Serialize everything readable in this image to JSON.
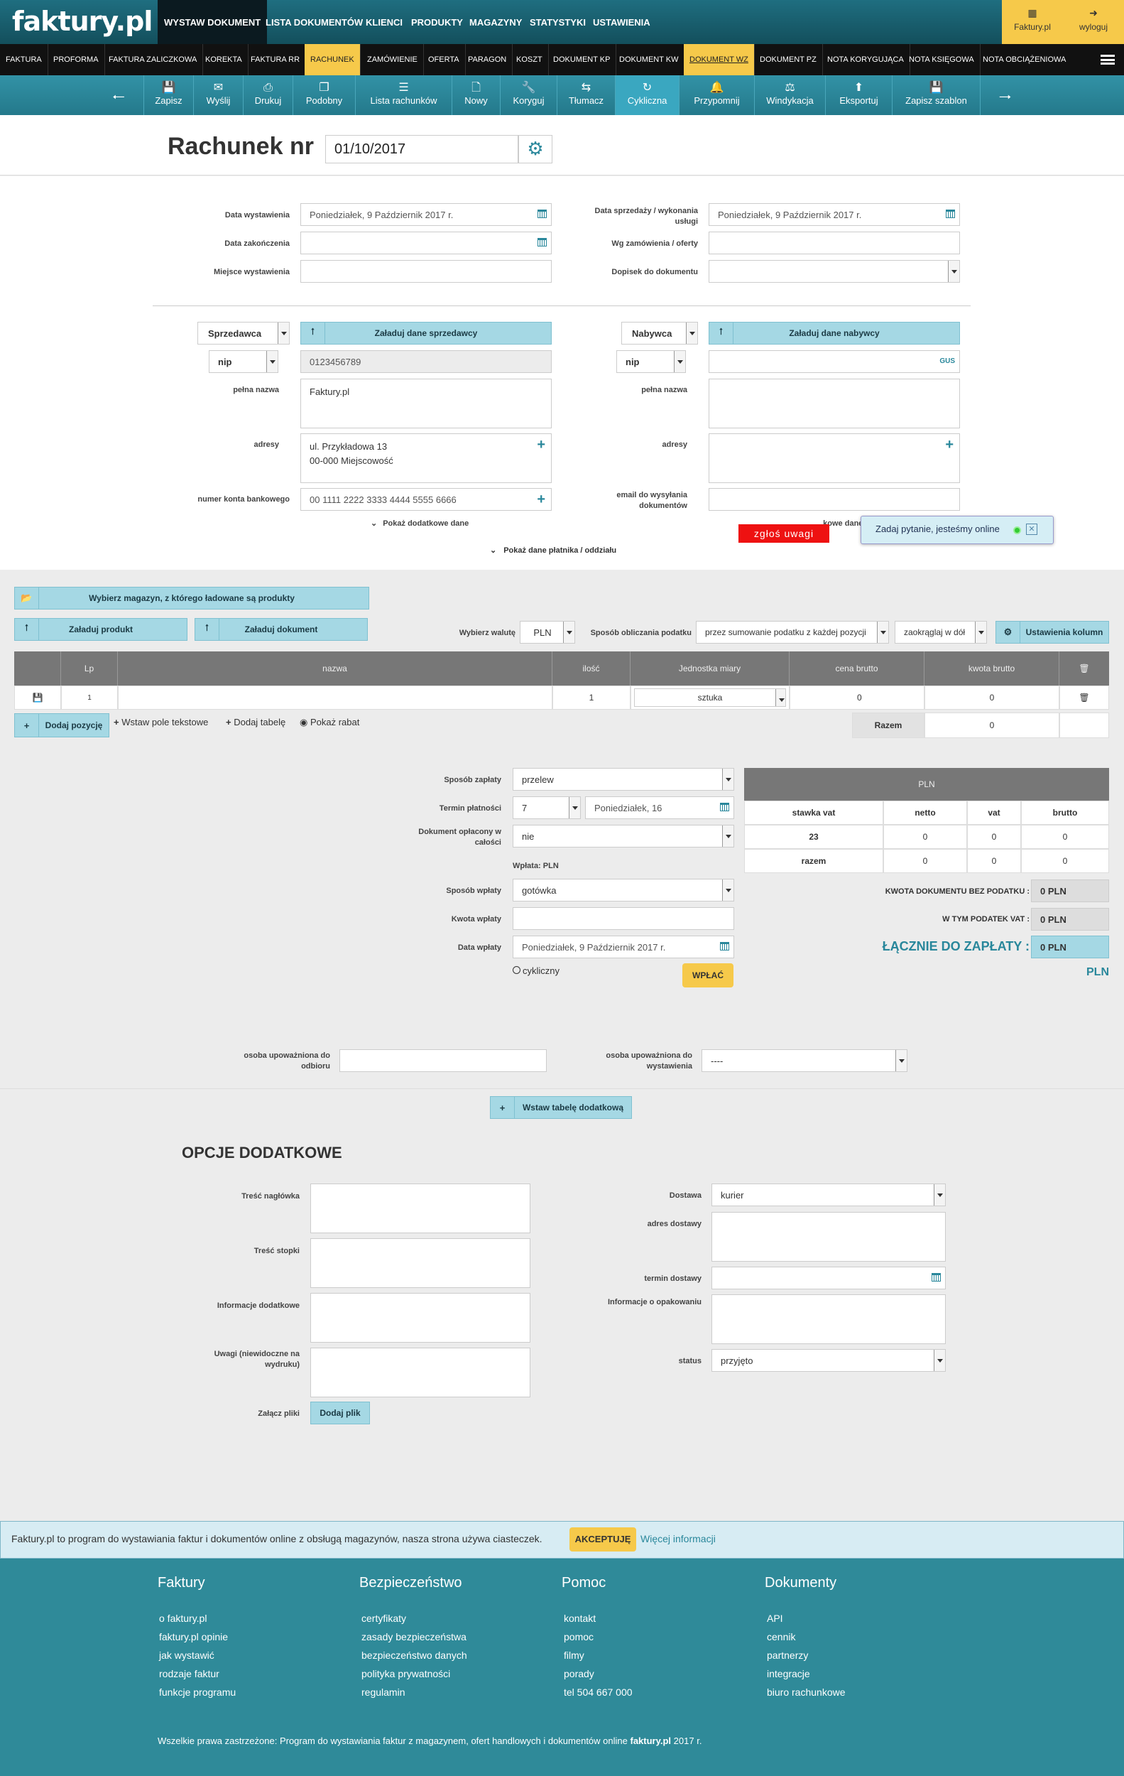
{
  "header": {
    "logo": "faktury.pl",
    "nav": [
      "WYSTAW DOKUMENT",
      "LISTA DOKUMENTÓW",
      "KLIENCI",
      "PRODUKTY",
      "MAGAZYNY",
      "STATYSTYKI",
      "USTAWIENIA"
    ],
    "account_label": "Faktury.pl",
    "logout_label": "wyloguj"
  },
  "doc_types": [
    "FAKTURA",
    "PROFORMA",
    "FAKTURA ZALICZKOWA",
    "KOREKTA",
    "FAKTURA RR",
    "RACHUNEK",
    "ZAMÓWIENIE",
    "OFERTA",
    "PARAGON",
    "KOSZT",
    "DOKUMENT KP",
    "DOKUMENT KW",
    "DOKUMENT WZ",
    "DOKUMENT PZ",
    "NOTA KORYGUJĄCA",
    "NOTA KSIĘGOWA",
    "NOTA OBCIĄŻENIOWA"
  ],
  "toolbar": [
    "Zapisz",
    "Wyślij",
    "Drukuj",
    "Podobny",
    "Lista rachunków",
    "Nowy",
    "Koryguj",
    "Tłumacz",
    "Cykliczna",
    "Przypomnij",
    "Windykacja",
    "Eksportuj",
    "Zapisz szablon"
  ],
  "doc": {
    "title": "Rachunek nr",
    "number": "01/10/2017"
  },
  "dates": {
    "issue_label": "Data wystawienia",
    "issue_value": "Poniedziałek, 9 Październik 2017 r.",
    "end_label": "Data zakończenia",
    "place_label": "Miejsce wystawienia",
    "sale_label": "Data sprzedaży / wykonania usługi",
    "sale_value": "Poniedziałek, 9 Październik 2017 r.",
    "order_label": "Wg zamówienia / oferty",
    "addon_label": "Dopisek do dokumentu"
  },
  "seller": {
    "role": "Sprzedawca",
    "load_btn": "Załaduj dane sprzedawcy",
    "id_type": "nip",
    "nip": "0123456789",
    "name_label": "pełna nazwa",
    "name": "Faktury.pl",
    "addr_label": "adresy",
    "addr1": "ul. Przykładowa 13",
    "addr2": "00-000 Miejscowość",
    "bank_label": "numer konta bankowego",
    "bank": "00 1111 2222 3333 4444 5555 6666",
    "more": "Pokaż dodatkowe dane"
  },
  "buyer": {
    "role": "Nabywca",
    "load_btn": "Załaduj dane nabywcy",
    "id_type": "nip",
    "gus": "GUS",
    "name_label": "pełna nazwa",
    "addr_label": "adresy",
    "email_label": "email do wysyłania dokumentów",
    "more_partial": "...kowe dane"
  },
  "payer_link": "Pokaż dane płatnika / oddziału",
  "report_btn": "zgłoś uwagi",
  "chat_text": "Zadaj pytanie, jesteśmy online",
  "products": {
    "warehouse_btn": "Wybierz magazyn, z którego ładowane są produkty",
    "load_product": "Załaduj produkt",
    "load_doc": "Załaduj dokument",
    "currency_label": "Wybierz walutę",
    "currency": "PLN",
    "tax_label": "Sposób obliczania podatku",
    "tax_method": "przez sumowanie podatku z każdej pozycji",
    "rounding": "zaokrąglaj w dół",
    "columns_btn": "Ustawienia kolumn",
    "headers": [
      "Lp",
      "nazwa",
      "ilość",
      "Jednostka miary",
      "cena brutto",
      "kwota brutto"
    ],
    "row": {
      "lp": "1",
      "qty": "1",
      "unit": "sztuka",
      "price": "0",
      "amount": "0"
    },
    "add_btn": "Dodaj pozycję",
    "text_field": "Wstaw pole tekstowe",
    "add_table": "Dodaj tabelę",
    "discount": "Pokaż rabat",
    "sum_label": "Razem",
    "sum_value": "0"
  },
  "payment": {
    "method_label": "Sposób zapłaty",
    "method": "przelew",
    "term_label": "Termin płatności",
    "term_days": "7",
    "term_date": "Poniedziałek, 16",
    "paid_label": "Dokument opłacony w całości",
    "paid": "nie",
    "deposit_label": "Wpłata: PLN",
    "dep_method_label": "Sposób wpłaty",
    "dep_method": "gotówka",
    "dep_amount_label": "Kwota wpłaty",
    "dep_date_label": "Data wpłaty",
    "dep_date": "Poniedziałek, 9 Październik 2017 r.",
    "cyclic": "cykliczny",
    "pay_btn": "WPŁAĆ"
  },
  "vat": {
    "currency": "PLN",
    "headers": [
      "stawka vat",
      "netto",
      "vat",
      "brutto"
    ],
    "rows": [
      [
        "23",
        "0",
        "0",
        "0"
      ],
      [
        "razem",
        "0",
        "0",
        "0"
      ]
    ],
    "net_label": "KWOTA DOKUMENTU BEZ PODATKU :",
    "net": "0 PLN",
    "tax_label": "W TYM PODATEK VAT :",
    "tax": "0 PLN",
    "total_label": "ŁĄCZNIE DO ZAPŁATY :",
    "total": "0 PLN",
    "total_currency": "PLN"
  },
  "persons": {
    "receive_label": "osoba upoważniona do odbioru",
    "issue_label": "osoba upoważniona do wystawienia",
    "issue_value": "----"
  },
  "extra_table_btn": "Wstaw tabelę dodatkową",
  "options": {
    "title": "OPCJE DODATKOWE",
    "header_label": "Treść nagłówka",
    "footer_label": "Treść stopki",
    "info_label": "Informacje dodatkowe",
    "notes_label": "Uwagi (niewidoczne na wydruku)",
    "attach_label": "Załącz pliki",
    "attach_btn": "Dodaj plik",
    "delivery_label": "Dostawa",
    "delivery": "kurier",
    "addr_label": "adres dostawy",
    "term_label": "termin dostawy",
    "pack_label": "Informacje o opakowaniu",
    "status_label": "status",
    "status": "przyjęto"
  },
  "cookie": {
    "text": "Faktury.pl to program do wystawiania faktur i dokumentów online z obsługą magazynów, nasza strona używa ciasteczek.",
    "accept": "AKCEPTUJĘ",
    "more": "Więcej informacji"
  },
  "footer": {
    "cols": [
      {
        "title": "Faktury",
        "links": [
          "o faktury.pl",
          "faktury.pl opinie",
          "jak wystawić",
          "rodzaje faktur",
          "funkcje programu"
        ]
      },
      {
        "title": "Bezpieczeństwo",
        "links": [
          "certyfikaty",
          "zasady bezpieczeństwa",
          "bezpieczeństwo danych",
          "polityka prywatności",
          "regulamin"
        ]
      },
      {
        "title": "Pomoc",
        "links": [
          "kontakt",
          "pomoc",
          "filmy",
          "porady",
          "tel 504 667 000"
        ]
      },
      {
        "title": "Dokumenty",
        "links": [
          "API",
          "cennik",
          "partnerzy",
          "integracje",
          "biuro rachunkowe"
        ]
      }
    ],
    "copyright": "Wszelkie prawa zastrzeżone: Program do wystawiania faktur z magazynem, ofert handlowych i dokumentów online",
    "copyright_brand": "faktury.pl",
    "copyright_year": "2017 r."
  }
}
